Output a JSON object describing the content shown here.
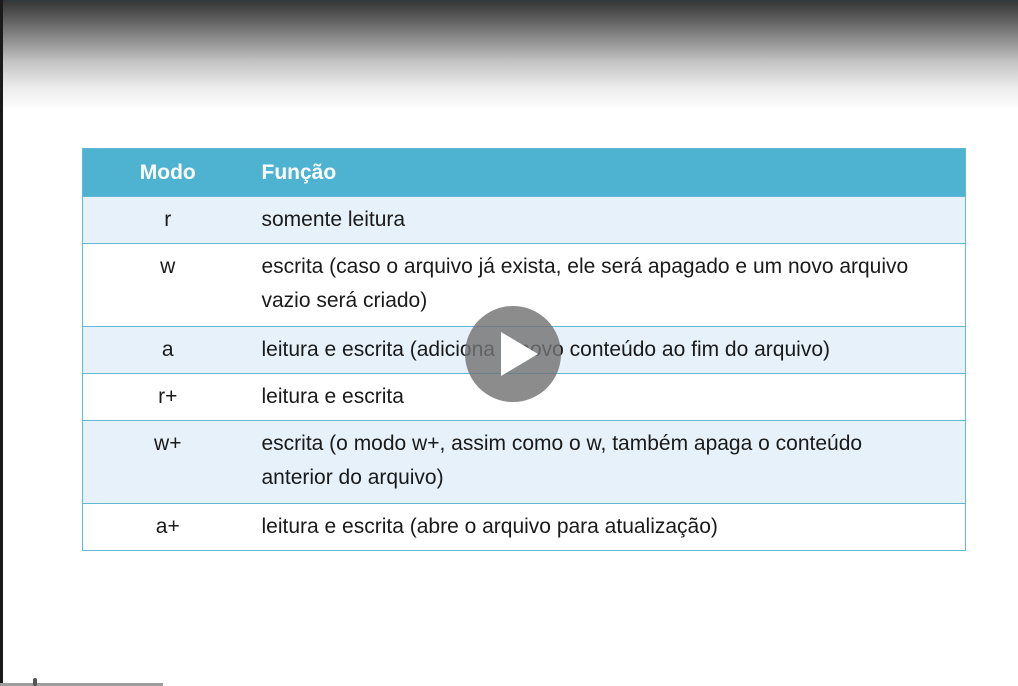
{
  "table": {
    "header": {
      "mode": "Modo",
      "function": "Função"
    },
    "rows": [
      {
        "mode": "r",
        "function": "somente leitura"
      },
      {
        "mode": "w",
        "function": "escrita (caso o arquivo já exista, ele será apagado e um novo arquivo vazio será criado)"
      },
      {
        "mode": "a",
        "function": "leitura e escrita (adiciona o novo conteúdo ao fim do arquivo)"
      },
      {
        "mode": "r+",
        "function": "leitura e escrita"
      },
      {
        "mode": "w+",
        "function": "escrita (o modo w+, assim como o w, também apaga o conteúdo anterior do arquivo)"
      },
      {
        "mode": "a+",
        "function": "leitura e escrita (abre o arquivo para atualização)"
      }
    ]
  },
  "player": {
    "play_icon": "play-icon",
    "progress": 0.2,
    "colors": {
      "header_bg": "#4db3d1",
      "row_alt_bg": "#e6f1fa",
      "border": "#62b9d6"
    }
  }
}
